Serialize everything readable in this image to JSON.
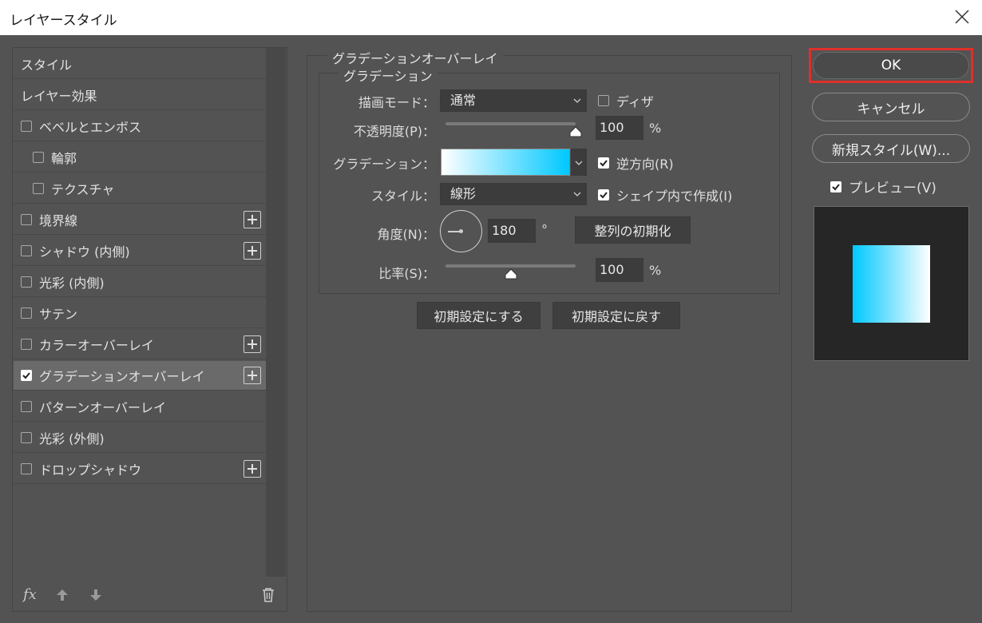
{
  "window": {
    "title": "レイヤースタイル"
  },
  "sidebar": {
    "items": [
      {
        "label": "スタイル",
        "checkbox": false,
        "checked": false,
        "plus": false
      },
      {
        "label": "レイヤー効果",
        "checkbox": false,
        "checked": false,
        "plus": false
      },
      {
        "label": "ベベルとエンボス",
        "checkbox": true,
        "checked": false,
        "plus": false
      },
      {
        "label": "輪郭",
        "checkbox": true,
        "checked": false,
        "plus": false,
        "indent": true
      },
      {
        "label": "テクスチャ",
        "checkbox": true,
        "checked": false,
        "plus": false,
        "indent": true
      },
      {
        "label": "境界線",
        "checkbox": true,
        "checked": false,
        "plus": true
      },
      {
        "label": "シャドウ (内側)",
        "checkbox": true,
        "checked": false,
        "plus": true
      },
      {
        "label": "光彩 (内側)",
        "checkbox": true,
        "checked": false,
        "plus": false
      },
      {
        "label": "サテン",
        "checkbox": true,
        "checked": false,
        "plus": false
      },
      {
        "label": "カラーオーバーレイ",
        "checkbox": true,
        "checked": false,
        "plus": true
      },
      {
        "label": "グラデーションオーバーレイ",
        "checkbox": true,
        "checked": true,
        "plus": true,
        "selected": true
      },
      {
        "label": "パターンオーバーレイ",
        "checkbox": true,
        "checked": false,
        "plus": false
      },
      {
        "label": "光彩 (外側)",
        "checkbox": true,
        "checked": false,
        "plus": false
      },
      {
        "label": "ドロップシャドウ",
        "checkbox": true,
        "checked": false,
        "plus": true
      }
    ],
    "tools": {
      "fx": "fx",
      "fx_icon": "fx-icon",
      "up_icon": "arrow-up-icon",
      "down_icon": "arrow-down-icon",
      "trash_icon": "trash-icon"
    }
  },
  "panel": {
    "group_title": "グラデーションオーバーレイ",
    "subgroup_title": "グラデーション",
    "blend_mode": {
      "label": "描画モード：",
      "value": "通常"
    },
    "dither": {
      "label": "ディザ",
      "checked": false
    },
    "opacity": {
      "label": "不透明度(P)：",
      "value": "100",
      "unit": "%",
      "level": 1.0
    },
    "gradient": {
      "label": "グラデーション：",
      "start_color": "#ffffff",
      "end_color": "#00c8ff"
    },
    "reverse": {
      "label": "逆方向(R)",
      "checked": true
    },
    "style": {
      "label": "スタイル：",
      "value": "線形"
    },
    "align_with_layer": {
      "label": "シェイプ内で作成(I)",
      "checked": true
    },
    "angle": {
      "label": "角度(N)：",
      "value": "180",
      "unit": "°"
    },
    "reset_alignment": "整列の初期化",
    "scale": {
      "label": "比率(S)：",
      "value": "100",
      "unit": "%",
      "level": 0.5
    },
    "make_default": "初期設定にする",
    "reset_default": "初期設定に戻す"
  },
  "actions": {
    "ok": "OK",
    "cancel": "キャンセル",
    "new_style": "新規スタイル(W)...",
    "preview": {
      "label": "プレビュー(V)",
      "checked": true
    }
  },
  "colors": {
    "accent_highlight": "#e0302a",
    "background": "#535353"
  }
}
